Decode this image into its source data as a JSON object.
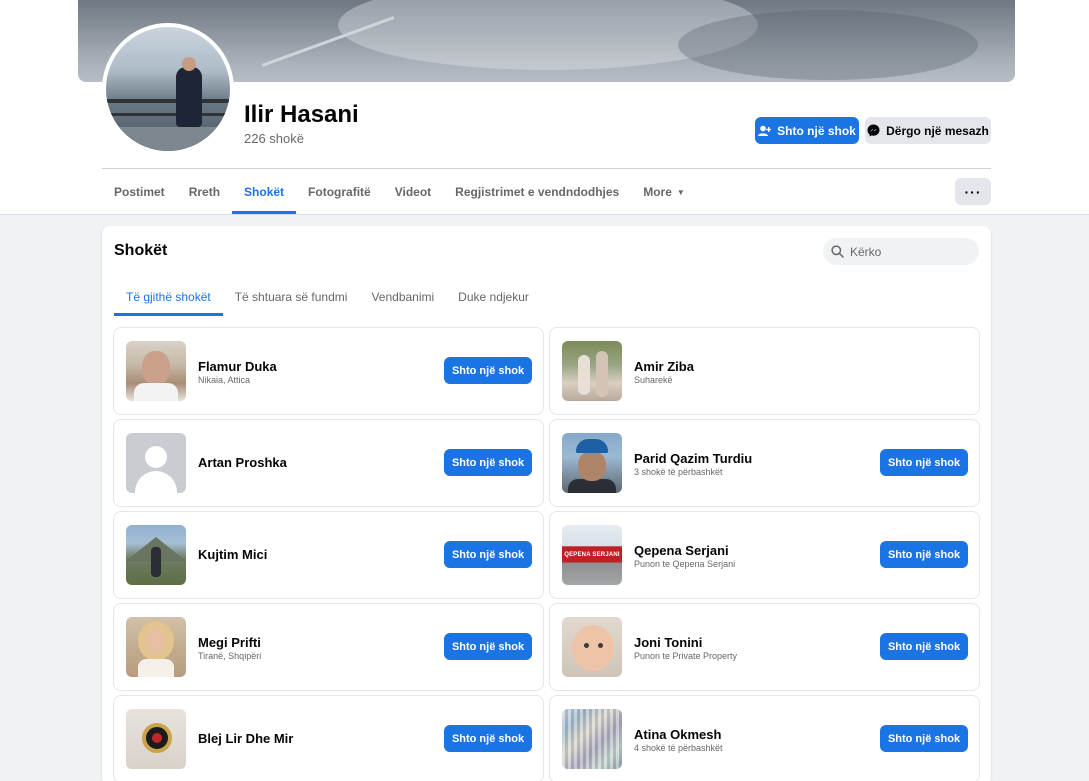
{
  "profile": {
    "name": "Ilir Hasani",
    "friends_count": "226 shokë",
    "add_friend_label": "Shto një shok",
    "message_label": "Dërgo një mesazh",
    "more_options": "···"
  },
  "tabs": [
    {
      "label": "Postimet"
    },
    {
      "label": "Rreth"
    },
    {
      "label": "Shokët"
    },
    {
      "label": "Fotografitë"
    },
    {
      "label": "Videot"
    },
    {
      "label": "Regjistrimet e vendndodhjes"
    },
    {
      "label": "More"
    }
  ],
  "friends": {
    "title": "Shokët",
    "search_placeholder": "Kërko",
    "subtabs": [
      {
        "label": "Të gjithë shokët"
      },
      {
        "label": "Të shtuara së fundmi"
      },
      {
        "label": "Vendbanimi"
      },
      {
        "label": "Duke ndjekur"
      }
    ],
    "add_label": "Shto një shok",
    "list": [
      {
        "name": "Flamur Duka",
        "sub": "Nikaia, Attica"
      },
      {
        "name": "Amir Ziba",
        "sub": "Suharekë"
      },
      {
        "name": "Artan Proshka",
        "sub": ""
      },
      {
        "name": "Parid Qazim Turdiu",
        "sub": "3 shokë të përbashkët"
      },
      {
        "name": "Kujtim Mici",
        "sub": ""
      },
      {
        "name": "Qepena Serjani",
        "sub": "Punon te Qepena Serjani"
      },
      {
        "name": "Megi Prifti",
        "sub": "Tiranë, Shqipëri"
      },
      {
        "name": "Joni Tonini",
        "sub": "Punon te Private Property"
      },
      {
        "name": "Blej Lir Dhe Mir",
        "sub": ""
      },
      {
        "name": "Atina Okmesh",
        "sub": "4 shokë të përbashkët"
      }
    ],
    "qepena_photo_text": "QEPENA SERJANI"
  },
  "colors": {
    "accent": "#1b74e4",
    "background": "#f0f2f5"
  }
}
